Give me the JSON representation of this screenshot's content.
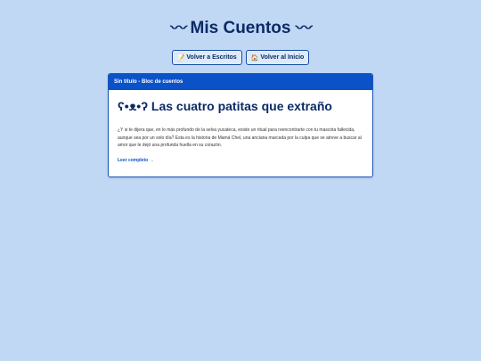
{
  "header": {
    "wave_left": "〰",
    "title": "Mis Cuentos",
    "wave_right": "〰"
  },
  "nav": {
    "back_writings": {
      "icon": "📝",
      "label": "Volver a Escritos"
    },
    "back_home": {
      "icon": "🏠",
      "label": "Volver al Inicio"
    }
  },
  "post": {
    "header_label": "Sin título - Bloc de cuentos",
    "title": "Las cuatro patitas que extraño",
    "title_emoticon": "ʕ•ᴥ•ʔ",
    "excerpt": "¿Y si te dijera que, en lo más profundo de la selva yucateca, existe un ritual para reencontrarte con tu mascota fallecida, aunque sea por un solo día? Esta es la historia de Mamá Chel, una anciana marcada por la culpa que se atreve a buscar al amor que le dejó una profunda huella en su corazón.",
    "read_more": "Leer completo →"
  },
  "colors": {
    "background": "#c0d8f4",
    "accent": "#0b52c8",
    "title_text": "#0b2a66"
  }
}
